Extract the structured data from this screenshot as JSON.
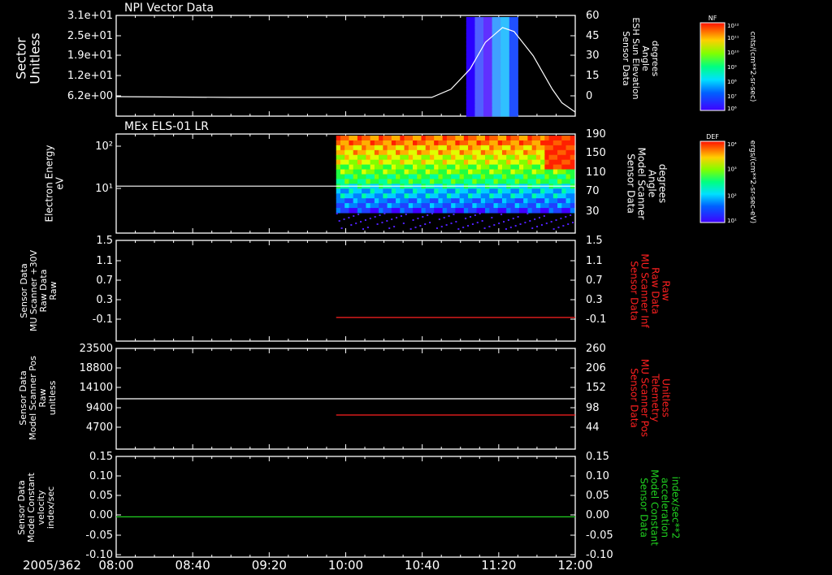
{
  "date_label": "2005/362",
  "time_ticks": [
    "08:00",
    "08:40",
    "09:20",
    "10:00",
    "10:40",
    "11:20",
    "12:00"
  ],
  "colors": {
    "white": "#ffffff",
    "red": "#ff2020",
    "green": "#20d020",
    "background": "#000000"
  },
  "colorbars": [
    {
      "tag": "NF",
      "top": "10¹²",
      "labels": [
        "10¹¹",
        "10¹⁰",
        "10⁹",
        "10⁸",
        "10⁷"
      ],
      "bottom": "10⁶",
      "units": "cnts/(cm**2-sr-sec)"
    },
    {
      "tag": "DEF",
      "top": "10⁴",
      "labels": [
        "10³",
        "10²"
      ],
      "bottom": "10¹",
      "units": "ergs/(cm**2-sr-sec-eV)"
    }
  ],
  "chart_data": [
    {
      "type": "heatmap",
      "title": "NPI Vector Data",
      "ylabel": [
        "Sector",
        "Unitless"
      ],
      "yticks": [
        "3.1e+01",
        "2.5e+01",
        "1.9e+01",
        "1.2e+01",
        "6.2e+00"
      ],
      "ylim": [
        0,
        31
      ],
      "right_label": [
        "Sensor Data",
        "ESH Sun Elevation",
        "Angle",
        "degrees"
      ],
      "right_ticks": [
        "60",
        "45",
        "30",
        "15",
        "0"
      ],
      "right_lim": [
        -15,
        60
      ],
      "xlim": [
        "08:00",
        "12:00"
      ],
      "heatmap_x_range": [
        "11:03",
        "11:30"
      ],
      "overlay_series": {
        "name": "ESH Sun Elevation",
        "color": "#ffffff",
        "points": [
          [
            "08:00",
            -0.5
          ],
          [
            "09:00",
            -1
          ],
          [
            "10:00",
            -1
          ],
          [
            "10:45",
            -1
          ],
          [
            "10:55",
            5
          ],
          [
            "11:05",
            20
          ],
          [
            "11:13",
            40
          ],
          [
            "11:22",
            51
          ],
          [
            "11:28",
            48
          ],
          [
            "11:38",
            30
          ],
          [
            "11:48",
            5
          ],
          [
            "11:53",
            -5
          ],
          [
            "12:00",
            -12
          ]
        ]
      }
    },
    {
      "type": "heatmap",
      "title": "MEx ELS-01 LR",
      "ylabel": [
        "Electron Energy",
        "eV"
      ],
      "yticks": [
        "10²",
        "10¹"
      ],
      "ylog": true,
      "right_label": [
        "Sensor Data",
        "Model Scanner",
        "Angle",
        "degrees"
      ],
      "right_ticks": [
        "190",
        "150",
        "110",
        "70",
        "30"
      ],
      "right_lim": [
        0,
        190
      ],
      "heatmap_x_range": [
        "09:55",
        "12:00"
      ],
      "overlay_series": {
        "name": "Model Scanner Angle",
        "color": "#ffffff",
        "constant": 90
      }
    },
    {
      "type": "line",
      "ylabel": [
        "Sensor Data",
        "MU Scanner +30V",
        "Raw Data",
        "Raw"
      ],
      "yticks": [
        "1.5",
        "1.1",
        "0.7",
        "0.3",
        "-0.1"
      ],
      "ylim": [
        -0.5,
        1.5
      ],
      "right_label": [
        "Sensor Data",
        "MU Scanner Inf",
        "Raw Data",
        "Raw"
      ],
      "right_ticks": [
        "1.5",
        "1.1",
        "0.7",
        "0.3",
        "-0.1"
      ],
      "right_lim": [
        -0.5,
        1.5
      ],
      "series": [
        {
          "name": "MU Scanner Inf Raw Data",
          "color": "#ff2020",
          "x_start": "09:55",
          "x_end": "12:00",
          "value": -0.03
        }
      ]
    },
    {
      "type": "line",
      "ylabel": [
        "Sensor Data",
        "Model Scanner Pos",
        "Raw",
        "unitless"
      ],
      "yticks": [
        "23500",
        "18800",
        "14100",
        "9400",
        "4700"
      ],
      "ylim": [
        0,
        23500
      ],
      "right_label": [
        "Sensor Data",
        "MU Scanner Pos",
        "Telemetry",
        "Unitless"
      ],
      "right_ticks": [
        "260",
        "206",
        "152",
        "98",
        "44"
      ],
      "right_lim": [
        0,
        260
      ],
      "series": [
        {
          "name": "Model Scanner Pos",
          "color": "#ffffff",
          "x_start": "08:00",
          "x_end": "12:00",
          "value": 11750
        },
        {
          "name": "MU Scanner Pos Telemetry",
          "color": "#ff2020",
          "x_start": "09:55",
          "x_end": "12:00",
          "value": 88
        }
      ]
    },
    {
      "type": "line",
      "ylabel": [
        "Sensor Data",
        "Model Constant",
        "velocity",
        "index/sec"
      ],
      "yticks": [
        "0.15",
        "0.10",
        "0.05",
        "0.00",
        "-0.05",
        "-0.10"
      ],
      "ylim": [
        -0.1,
        0.15
      ],
      "right_label": [
        "Sensor Data",
        "Model Constant",
        "acceleration",
        "index/sec**2"
      ],
      "right_ticks": [
        "0.15",
        "0.10",
        "0.05",
        "0.00",
        "-0.05",
        "-0.10"
      ],
      "right_lim": [
        -0.1,
        0.15
      ],
      "series": [
        {
          "name": "Model Constant acceleration",
          "color": "#20d020",
          "x_start": "08:00",
          "x_end": "12:00",
          "value": 0.0
        }
      ]
    }
  ]
}
